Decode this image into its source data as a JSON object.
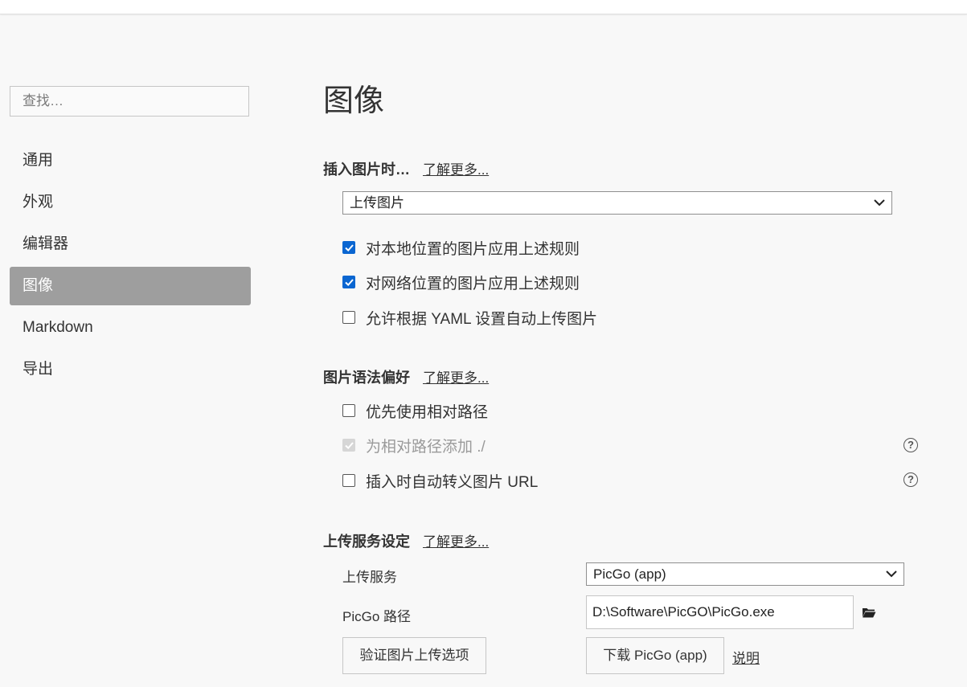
{
  "sidebar": {
    "search_placeholder": "查找…",
    "items": [
      {
        "label": "通用"
      },
      {
        "label": "外观"
      },
      {
        "label": "编辑器"
      },
      {
        "label": "图像",
        "active": true
      },
      {
        "label": "Markdown"
      },
      {
        "label": "导出"
      }
    ]
  },
  "main": {
    "title": "图像",
    "insert": {
      "title": "插入图片时…",
      "learn_more": "了解更多...",
      "select_value": "上传图片",
      "options": [
        {
          "label": "对本地位置的图片应用上述规则",
          "checked": true
        },
        {
          "label": "对网络位置的图片应用上述规则",
          "checked": true
        },
        {
          "label": "允许根据 YAML 设置自动上传图片",
          "checked": false
        }
      ]
    },
    "syntax": {
      "title": "图片语法偏好",
      "learn_more": "了解更多...",
      "options": [
        {
          "label": "优先使用相对路径",
          "checked": false
        },
        {
          "label": "为相对路径添加 ./",
          "checked": true,
          "disabled": true
        },
        {
          "label": "插入时自动转义图片 URL",
          "checked": false
        }
      ]
    },
    "upload": {
      "title": "上传服务设定",
      "learn_more": "了解更多...",
      "service_label": "上传服务",
      "service_value": "PicGo (app)",
      "path_label": "PicGo 路径",
      "path_value": "D:\\Software\\PicGO\\PicGo.exe",
      "verify_button": "验证图片上传选项",
      "download_button": "下载 PicGo (app)",
      "help_link": "说明"
    }
  },
  "colors": {
    "accent": "#0a66d1",
    "active_nav": "#9e9e9e",
    "background": "#f8f8f8"
  }
}
